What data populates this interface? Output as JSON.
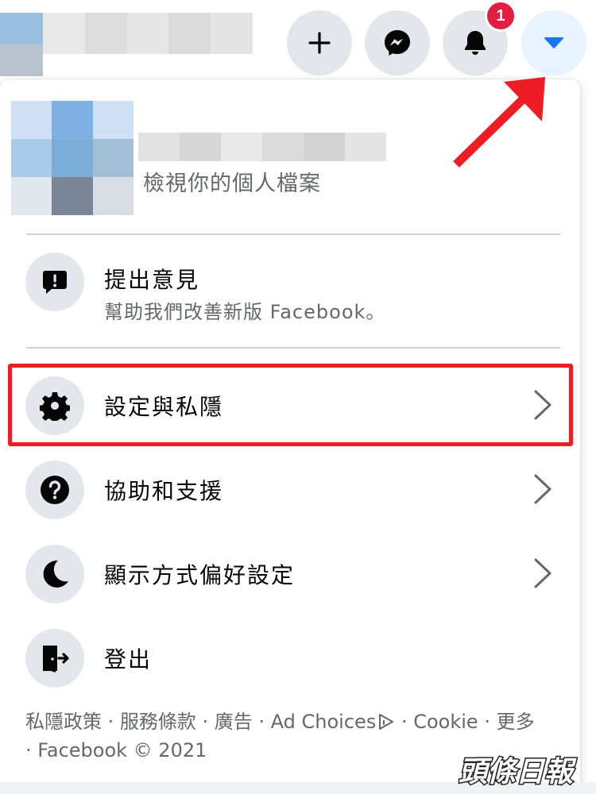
{
  "topbar": {
    "create_icon": "plus-icon",
    "messenger_icon": "messenger-icon",
    "notifications_icon": "bell-icon",
    "notification_count": "1",
    "account_icon": "caret-down-icon"
  },
  "profile": {
    "subtitle": "檢視你的個人檔案"
  },
  "menu": {
    "feedback": {
      "label": "提出意見",
      "sub": "幫助我們改善新版 Facebook。",
      "icon": "feedback-exclamation-icon"
    },
    "items": [
      {
        "label": "設定與私隱",
        "icon": "gear-icon",
        "has_submenu": true
      },
      {
        "label": "協助和支援",
        "icon": "question-icon",
        "has_submenu": true
      },
      {
        "label": "顯示方式偏好設定",
        "icon": "moon-icon",
        "has_submenu": true
      },
      {
        "label": "登出",
        "icon": "logout-icon",
        "has_submenu": false
      }
    ]
  },
  "footer": {
    "privacy": "私隱政策",
    "terms": "服務條款",
    "ads": "廣告",
    "ad_choices": "Ad Choices",
    "cookie": "Cookie",
    "more": "更多",
    "copyright": "Facebook © 2021",
    "sep": " · "
  },
  "watermark": "頭條日報",
  "colors": {
    "annotation_red": "#ee1c25",
    "active_blue": "#1877f2",
    "badge_red": "#e41e3f",
    "icon_bg": "#e4e6eb"
  }
}
